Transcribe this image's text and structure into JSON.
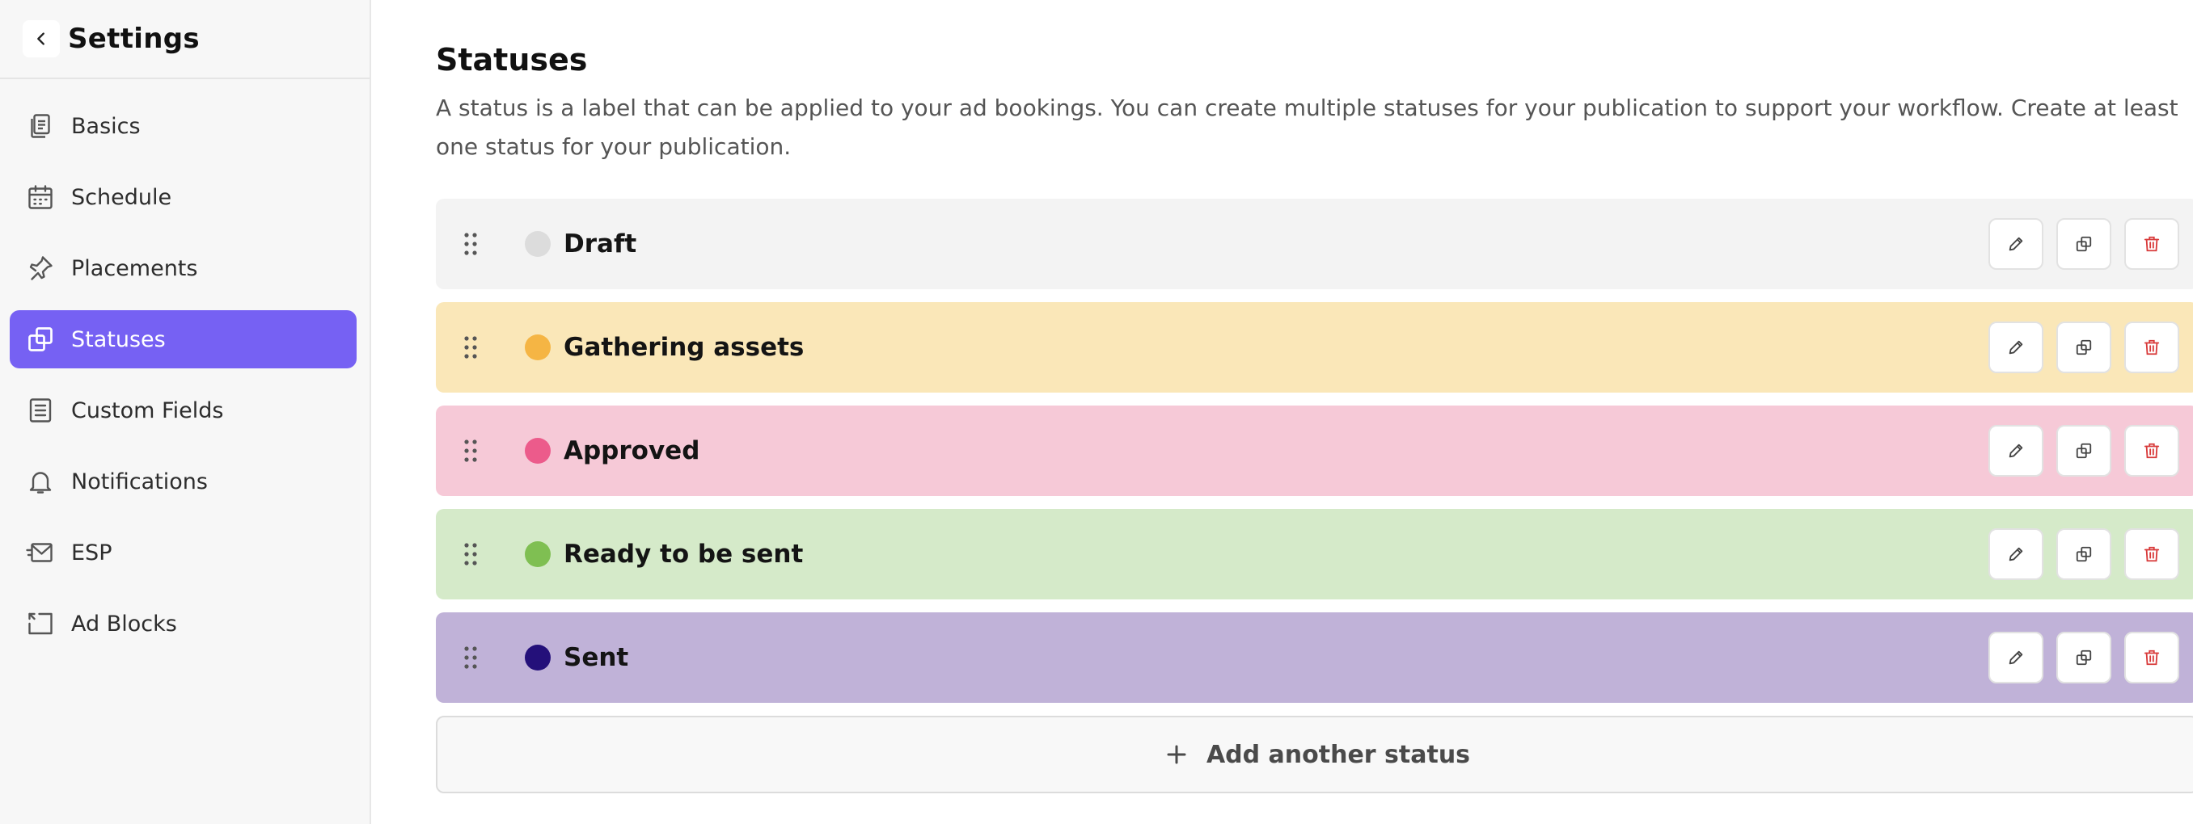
{
  "sidebar": {
    "title": "Settings",
    "items": [
      {
        "label": "Basics",
        "icon": "document-copy-icon",
        "active": false
      },
      {
        "label": "Schedule",
        "icon": "calendar-icon",
        "active": false
      },
      {
        "label": "Placements",
        "icon": "pin-icon",
        "active": false
      },
      {
        "label": "Statuses",
        "icon": "copy-icon",
        "active": true
      },
      {
        "label": "Custom Fields",
        "icon": "form-icon",
        "active": false
      },
      {
        "label": "Notifications",
        "icon": "bell-icon",
        "active": false
      },
      {
        "label": "ESP",
        "icon": "mail-icon",
        "active": false
      },
      {
        "label": "Ad Blocks",
        "icon": "ad-block-icon",
        "active": false
      }
    ]
  },
  "main": {
    "title": "Statuses",
    "description": "A status is a label that can be applied to your ad bookings. You can create multiple statuses for your publication to support your workflow. Create at least one status for your publication.",
    "statuses": [
      {
        "name": "Draft",
        "dot_color": "#dcdcdc",
        "bg_color": "#f3f3f3"
      },
      {
        "name": "Gathering assets",
        "dot_color": "#f5b544",
        "bg_color": "#fae7b8"
      },
      {
        "name": "Approved",
        "dot_color": "#ec5b8b",
        "bg_color": "#f6c9d7"
      },
      {
        "name": "Ready to be sent",
        "dot_color": "#7fbf52",
        "bg_color": "#d5eac9"
      },
      {
        "name": "Sent",
        "dot_color": "#24107a",
        "bg_color": "#c0b2d8"
      }
    ],
    "add_label": "Add another status"
  },
  "colors": {
    "accent": "#7661f3",
    "delete": "#d83a3a"
  }
}
